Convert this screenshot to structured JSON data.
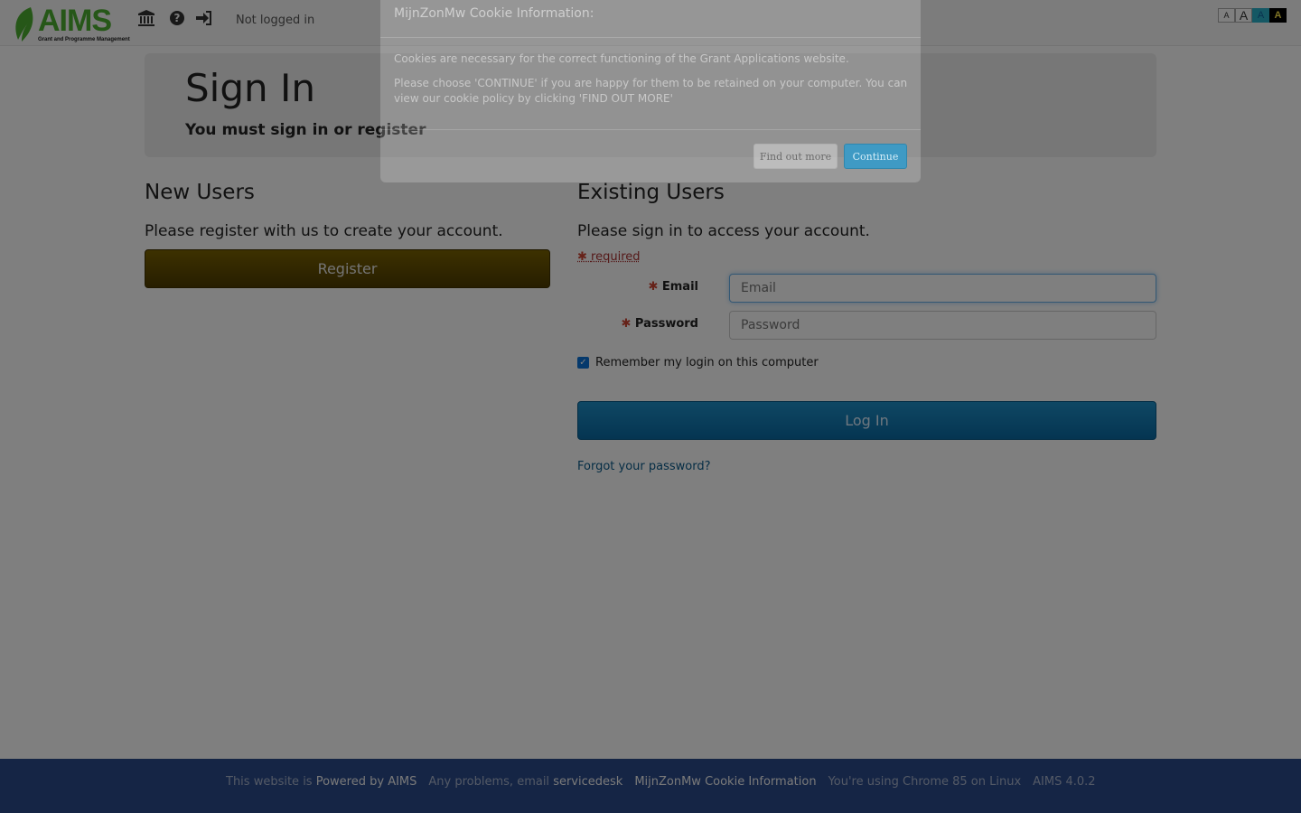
{
  "navbar": {
    "logo_text": "AIMS",
    "logo_subtitle": "Grant and Programme Management",
    "status": "Not logged in",
    "font_sizes": [
      "A",
      "A",
      "A",
      "A"
    ]
  },
  "jumbotron": {
    "title": "Sign In",
    "subtitle": "You must sign in or register"
  },
  "new_users": {
    "heading": "New Users",
    "text": "Please register with us to create your account.",
    "register_label": "Register"
  },
  "existing_users": {
    "heading": "Existing Users",
    "text": "Please sign in to access your account.",
    "required_legend": "required",
    "email_label": "Email",
    "email_placeholder": "Email",
    "password_label": "Password",
    "password_placeholder": "Password",
    "remember_label": "Remember my login on this computer",
    "remember_checked": true,
    "login_label": "Log In",
    "forgot_label": "Forgot your password?"
  },
  "footer": {
    "powered_prefix": "This website is",
    "powered_link": "Powered by AIMS",
    "problems_prefix": "Any problems, email",
    "servicedesk_link": "servicedesk",
    "cookie_link": "MijnZonMw Cookie Information",
    "browser_info": "You're using Chrome 85 on Linux",
    "version": "AIMS 4.0.2"
  },
  "cookie_modal": {
    "title": "MijnZonMw Cookie Information:",
    "paragraph1": "Cookies are necessary for the correct functioning of the Grant Applications website.",
    "paragraph2": "Please choose 'CONTINUE' if you are happy for them to be retained on your computer. You can view our cookie policy by clicking 'FIND OUT MORE'",
    "find_out_more_label": "Find out more",
    "continue_label": "Continue"
  },
  "colors": {
    "register_button": "#5e4a00",
    "login_button": "#1279b2",
    "footer_bg": "#2b4a8a",
    "logo_green": "#4caf30"
  }
}
